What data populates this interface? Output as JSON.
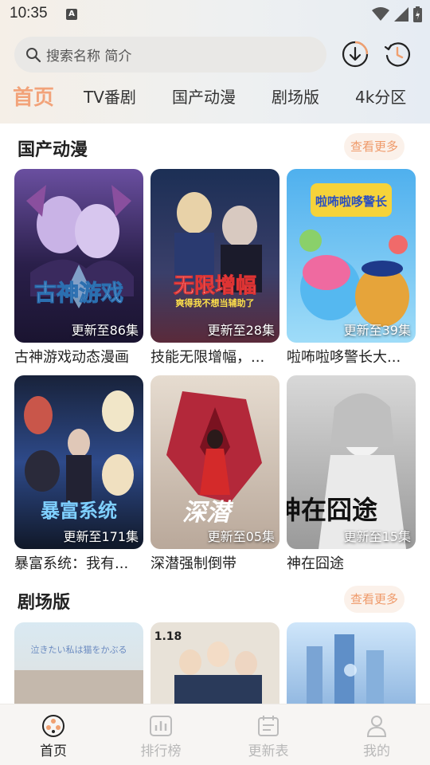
{
  "status": {
    "time": "10:35",
    "notif": "A"
  },
  "search": {
    "placeholder": "搜索名称 简介"
  },
  "tabs": [
    {
      "label": "首页",
      "active": true
    },
    {
      "label": "TV番剧"
    },
    {
      "label": "国产动漫"
    },
    {
      "label": "剧场版"
    },
    {
      "label": "4k分区"
    }
  ],
  "sections": [
    {
      "title": "国产动漫",
      "more": "查看更多",
      "items": [
        {
          "title": "古神游戏动态漫画",
          "episode": "更新至86集",
          "poster_text": "古神游戏"
        },
        {
          "title": "技能无限增幅，...",
          "episode": "更新至28集",
          "poster_text": "无限增幅",
          "poster_sub": "爽得我不想当辅助了"
        },
        {
          "title": "啦咘啦哆警长大...",
          "episode": "更新至39集",
          "poster_text": "啦咘啦哆警长"
        },
        {
          "title": "暴富系统：我有...",
          "episode": "更新至171集",
          "poster_text": "暴富系统"
        },
        {
          "title": "深潜强制倒带",
          "episode": "更新至05集",
          "poster_text": "深潜"
        },
        {
          "title": "神在囧途",
          "episode": "更新至15集",
          "poster_text": "神在囧途"
        }
      ]
    },
    {
      "title": "剧场版",
      "more": "查看更多",
      "items": [
        {
          "poster_text": "泣きたい私は猫をかぶる"
        },
        {
          "poster_text": "1.18"
        },
        {
          "poster_text": ""
        }
      ]
    }
  ],
  "nav": [
    {
      "label": "首页",
      "icon": "film-reel-icon",
      "active": true
    },
    {
      "label": "排行榜",
      "icon": "bar-chart-icon"
    },
    {
      "label": "更新表",
      "icon": "calendar-icon"
    },
    {
      "label": "我的",
      "icon": "user-icon"
    }
  ],
  "colors": {
    "accent": "#f2a37a",
    "more_bg": "#fbf1ea",
    "more_text": "#ef9a6a"
  }
}
